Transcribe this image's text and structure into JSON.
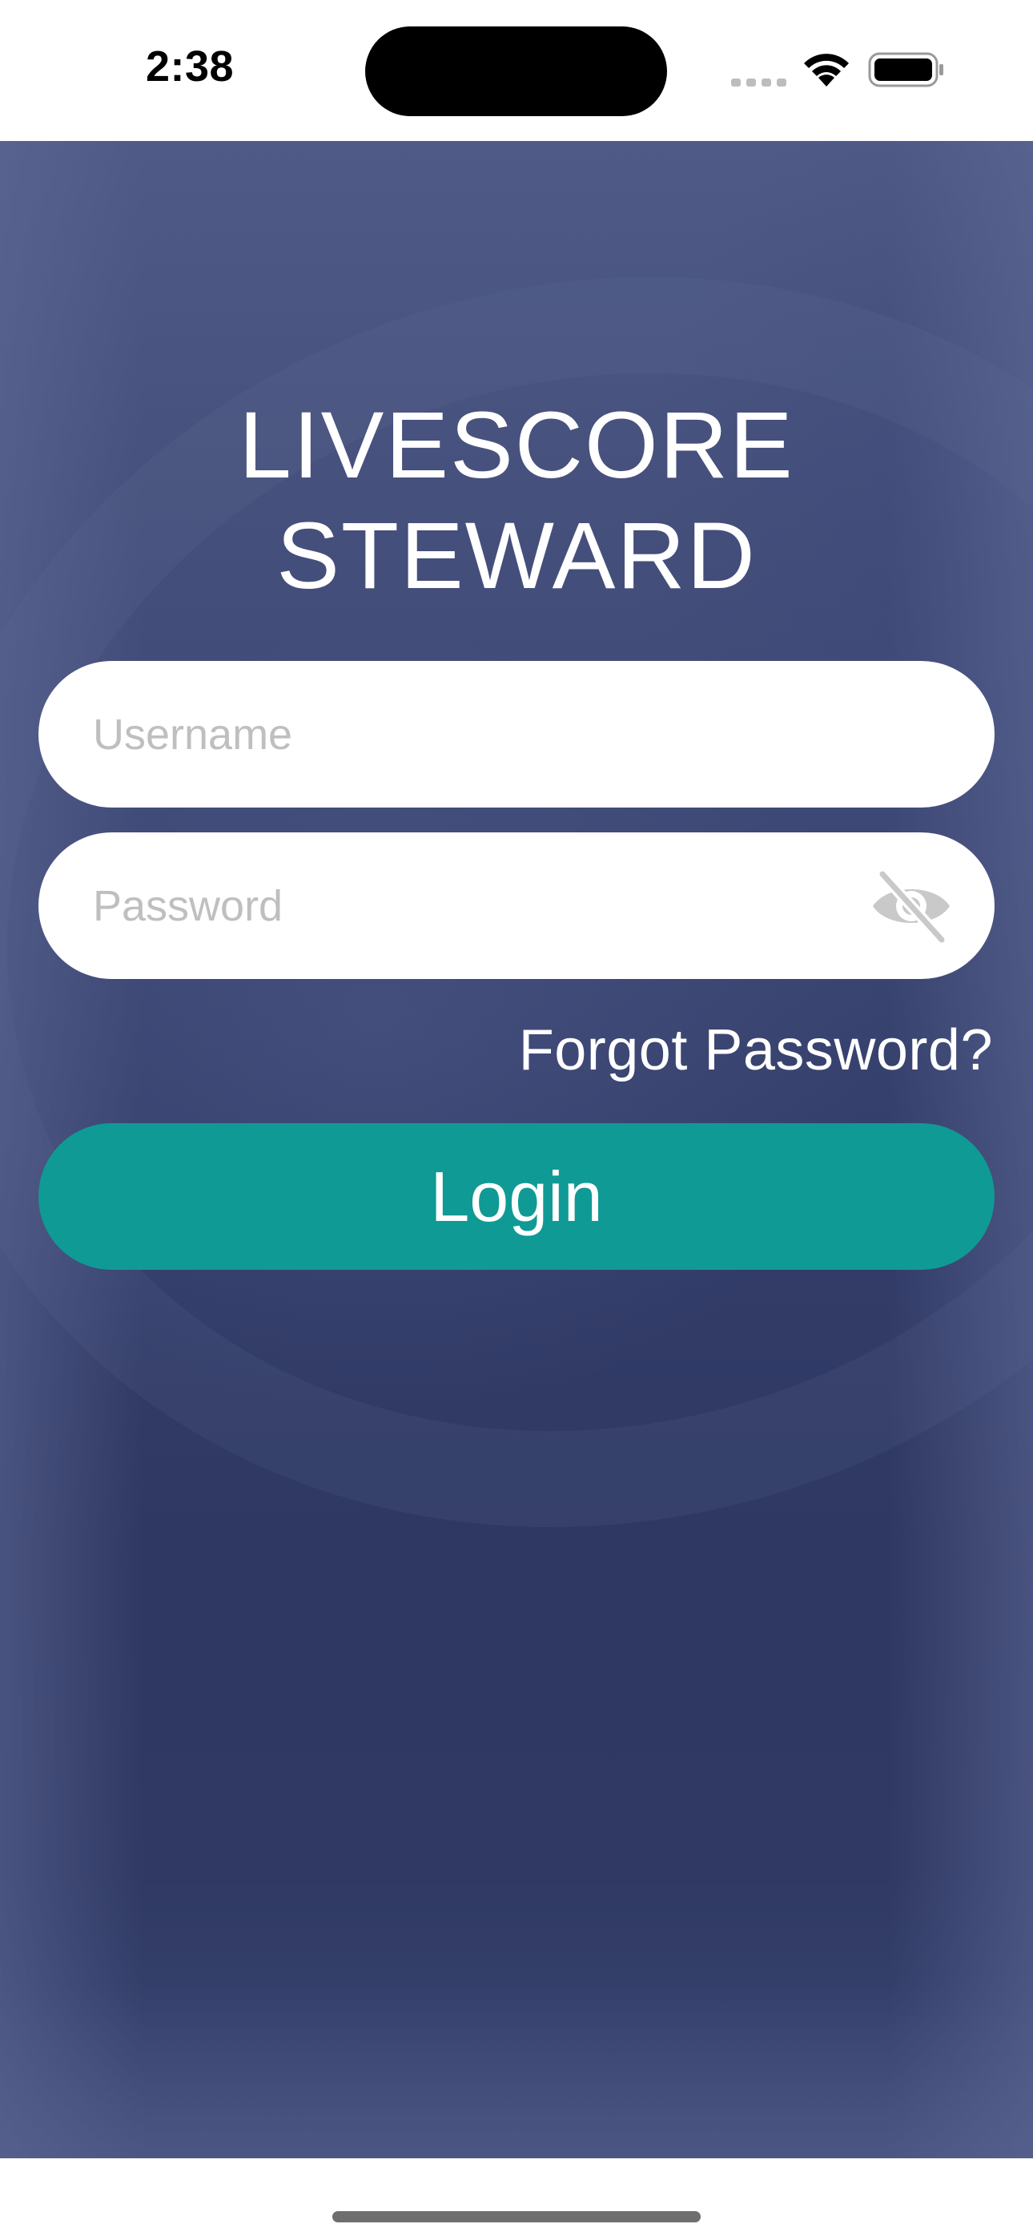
{
  "status_bar": {
    "time": "2:38"
  },
  "app": {
    "title_line1": "LIVESCORE",
    "title_line2": "STEWARD"
  },
  "form": {
    "username_placeholder": "Username",
    "password_placeholder": "Password",
    "forgot_password_label": "Forgot Password?",
    "login_label": "Login"
  },
  "icons": {
    "password_toggle": "eye-slash-icon",
    "wifi": "wifi-icon",
    "battery": "battery-icon",
    "signal": "cellular-signal-icon"
  },
  "colors": {
    "background_top": "#4f5a86",
    "background_bottom": "#2e3862",
    "login_button": "#109a95",
    "placeholder_text": "#bfbfbf"
  }
}
